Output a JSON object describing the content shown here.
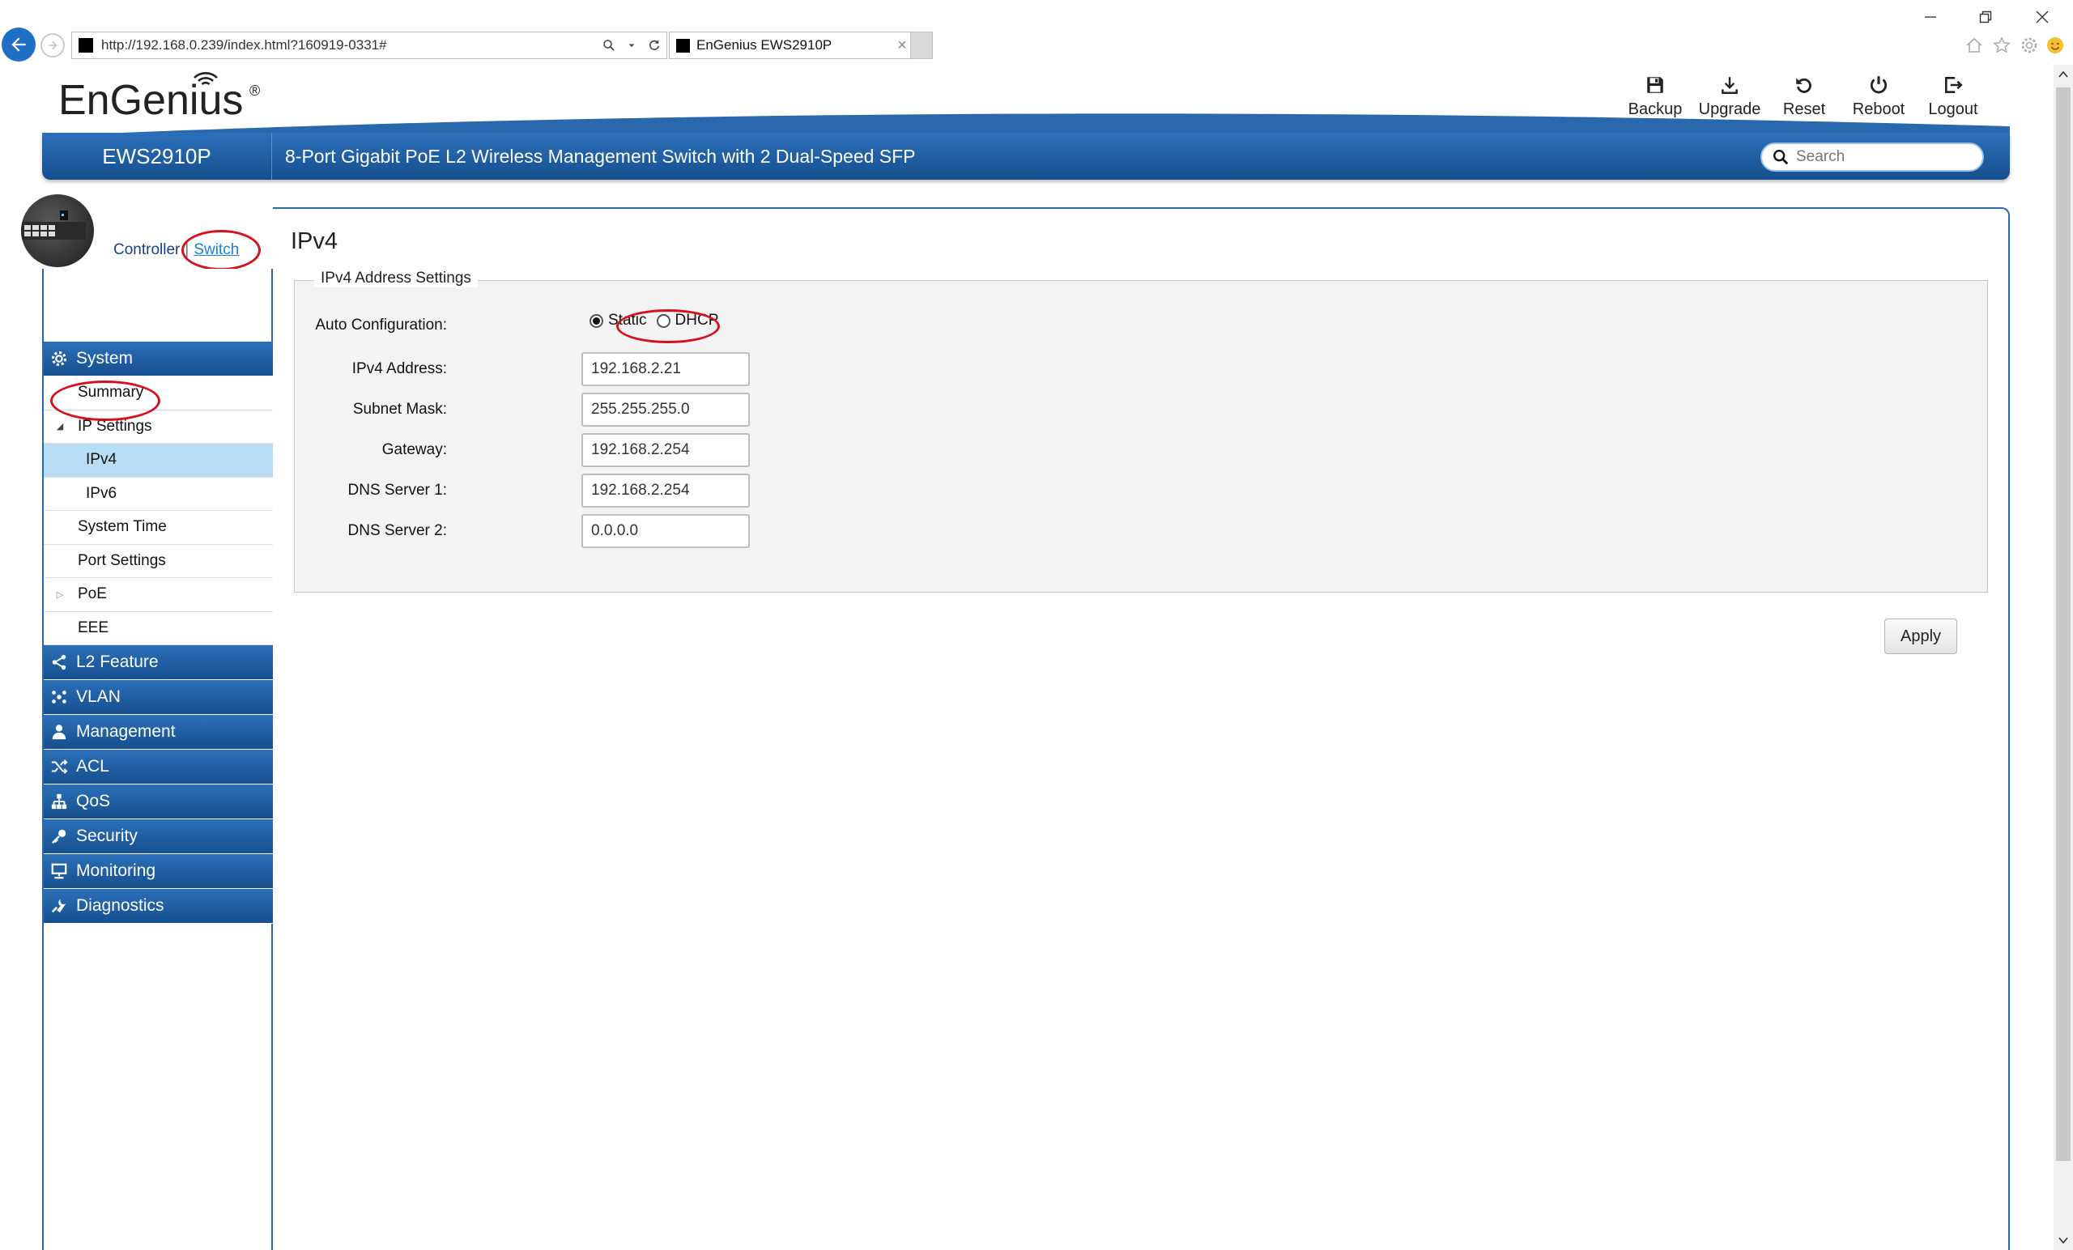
{
  "browser": {
    "url": "http://192.168.0.239/index.html?160919-0331#",
    "tab_title": "EnGenius EWS2910P",
    "tab_close": "×"
  },
  "header": {
    "logo": "EnGenius",
    "logo_mark": "®",
    "tools": {
      "backup": "Backup",
      "upgrade": "Upgrade",
      "reset": "Reset",
      "reboot": "Reboot",
      "logout": "Logout"
    },
    "model": "EWS2910P",
    "description": "8-Port Gigabit PoE L2 Wireless Management Switch with 2 Dual-Speed SFP",
    "search_placeholder": "Search"
  },
  "mode": {
    "controller": "Controller",
    "separator": "|",
    "switch": "Switch"
  },
  "sidebar": {
    "system": "System",
    "summary": "Summary",
    "ip_settings": "IP Settings",
    "ipv4": "IPv4",
    "ipv6": "IPv6",
    "system_time": "System Time",
    "port_settings": "Port Settings",
    "poe": "PoE",
    "eee": "EEE",
    "l2_feature": "L2 Feature",
    "vlan": "VLAN",
    "management": "Management",
    "acl": "ACL",
    "qos": "QoS",
    "security": "Security",
    "monitoring": "Monitoring",
    "diagnostics": "Diagnostics"
  },
  "content": {
    "title": "IPv4",
    "legend": "IPv4 Address Settings",
    "auto_config_label": "Auto Configuration:",
    "static_label": "Static",
    "dhcp_label": "DHCP",
    "ipv4_address_label": "IPv4 Address:",
    "ipv4_address": "192.168.2.21",
    "subnet_mask_label": "Subnet Mask:",
    "subnet_mask": "255.255.255.0",
    "gateway_label": "Gateway:",
    "gateway": "192.168.2.254",
    "dns1_label": "DNS Server 1:",
    "dns1": "192.168.2.254",
    "dns2_label": "DNS Server 2:",
    "dns2": "0.0.0.0",
    "apply": "Apply"
  },
  "colors": {
    "header_blue": "#1f5fa6",
    "active_row": "#b9ddf6",
    "highlight_ring": "#d8101c"
  }
}
